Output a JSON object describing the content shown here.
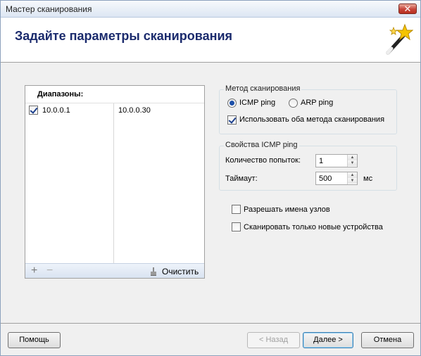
{
  "window": {
    "title": "Мастер сканирования",
    "close_glyph": "✕"
  },
  "header": {
    "title": "Задайте параметры сканирования",
    "icon": "magic-wand-icon"
  },
  "ranges": {
    "heading": "Диапазоны:",
    "rows": [
      {
        "checked": true,
        "start": "10.0.0.1",
        "end": "10.0.0.30"
      }
    ],
    "add_glyph": "+",
    "remove_glyph": "−",
    "clear_label": "Очистить"
  },
  "scan_method": {
    "title": "Метод сканирования",
    "icmp_label": "ICMP ping",
    "arp_label": "ARP ping",
    "selected": "icmp",
    "both_label": "Использовать оба метода сканирования",
    "both_checked": true
  },
  "icmp_props": {
    "title": "Свойства ICMP ping",
    "attempts_label": "Количество попыток:",
    "attempts_value": "1",
    "timeout_label": "Таймаут:",
    "timeout_value": "500",
    "timeout_unit": "мс"
  },
  "options": {
    "resolve_names_label": "Разрешать имена узлов",
    "resolve_names_checked": false,
    "new_only_label": "Сканировать только новые устройства",
    "new_only_checked": false
  },
  "buttons": {
    "help": "Помощь",
    "back": "< Назад",
    "next": "Далее >",
    "cancel": "Отмена"
  },
  "colors": {
    "header_title": "#1b2b6d",
    "accent": "#1c4fa8"
  }
}
